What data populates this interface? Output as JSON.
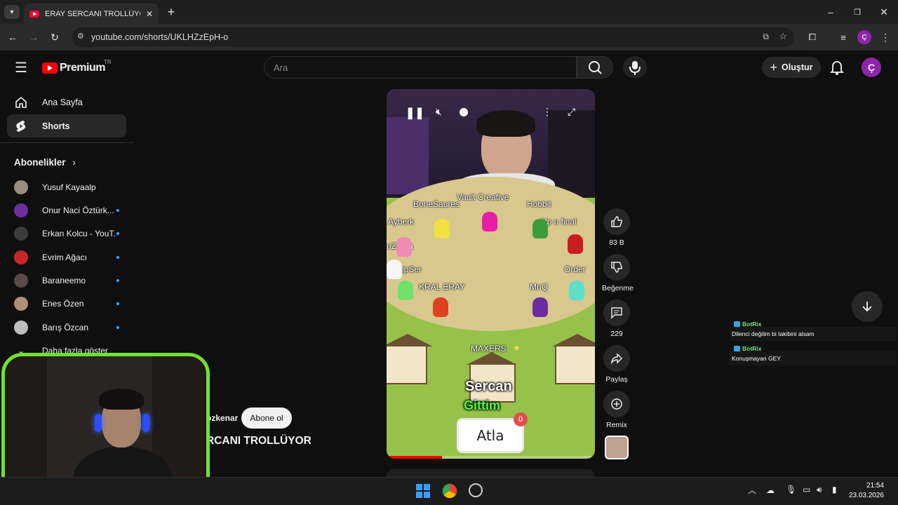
{
  "browser": {
    "tab_title": "ERAY SERCANI TROLLÜYOR - YouTube",
    "url": "youtube.com/shorts/UKLHZzEpH-o",
    "profile_initial": "Ç"
  },
  "header": {
    "logo_text": "Premium",
    "country_code": "TR",
    "search_placeholder": "Ara",
    "create_label": "Oluştur",
    "avatar_initial": "Ç"
  },
  "sidebar": {
    "items": [
      {
        "label": "Ana Sayfa",
        "icon": "home-icon"
      },
      {
        "label": "Shorts",
        "icon": "shorts-icon"
      }
    ],
    "subscriptions_title": "Abonelikler",
    "subscriptions": [
      {
        "name": "Yusuf Kayaalp",
        "color": "#9a8d7e",
        "dot": false
      },
      {
        "name": "Onur Naci Öztürk...",
        "color": "#6b2fa0",
        "dot": true
      },
      {
        "name": "Erkan Kolcu - YouT...",
        "color": "#3b3b3b",
        "dot": true
      },
      {
        "name": "Evrim Ağacı",
        "color": "#c62828",
        "dot": true
      },
      {
        "name": "Baraneemo",
        "color": "#5a4a4a",
        "dot": true
      },
      {
        "name": "Enes Özen",
        "color": "#b08e77",
        "dot": true
      },
      {
        "name": "Barış Özcan",
        "color": "#bdbdbd",
        "dot": true
      }
    ],
    "show_more": "Daha fazla göster"
  },
  "short": {
    "labels": {
      "vault": "Vault Creative",
      "bone": "BoneSaures",
      "hobbit": "Hobbit",
      "ayberk": "Ayberk",
      "alp": "Alp n final",
      "zurna": "nZurna",
      "alpser": "AlpSer",
      "order": "Order",
      "kral": "KRAL ERAY",
      "mnq": "MnQ",
      "maxers": "MAXERS"
    },
    "caption_line1": "Sercan",
    "caption_line2": "Gittim",
    "skip_label": "Atla",
    "skip_count": "0",
    "channel": "ozkenar",
    "subscribe_label": "Abone ol",
    "title": "RCANI TROLLÜYOR"
  },
  "actions": {
    "likes": "83 B",
    "dislike_label": "Beğenme",
    "comments": "229",
    "share_label": "Paylaş",
    "remix_label": "Remix"
  },
  "chat": [
    {
      "user": "BotRix",
      "message": "Dilenci değilim bi takibini alsam"
    },
    {
      "user": "BotRix",
      "message": "Konuşmayan GEY"
    }
  ],
  "taskbar": {
    "time": "21:54",
    "date": "23.03.2026"
  }
}
